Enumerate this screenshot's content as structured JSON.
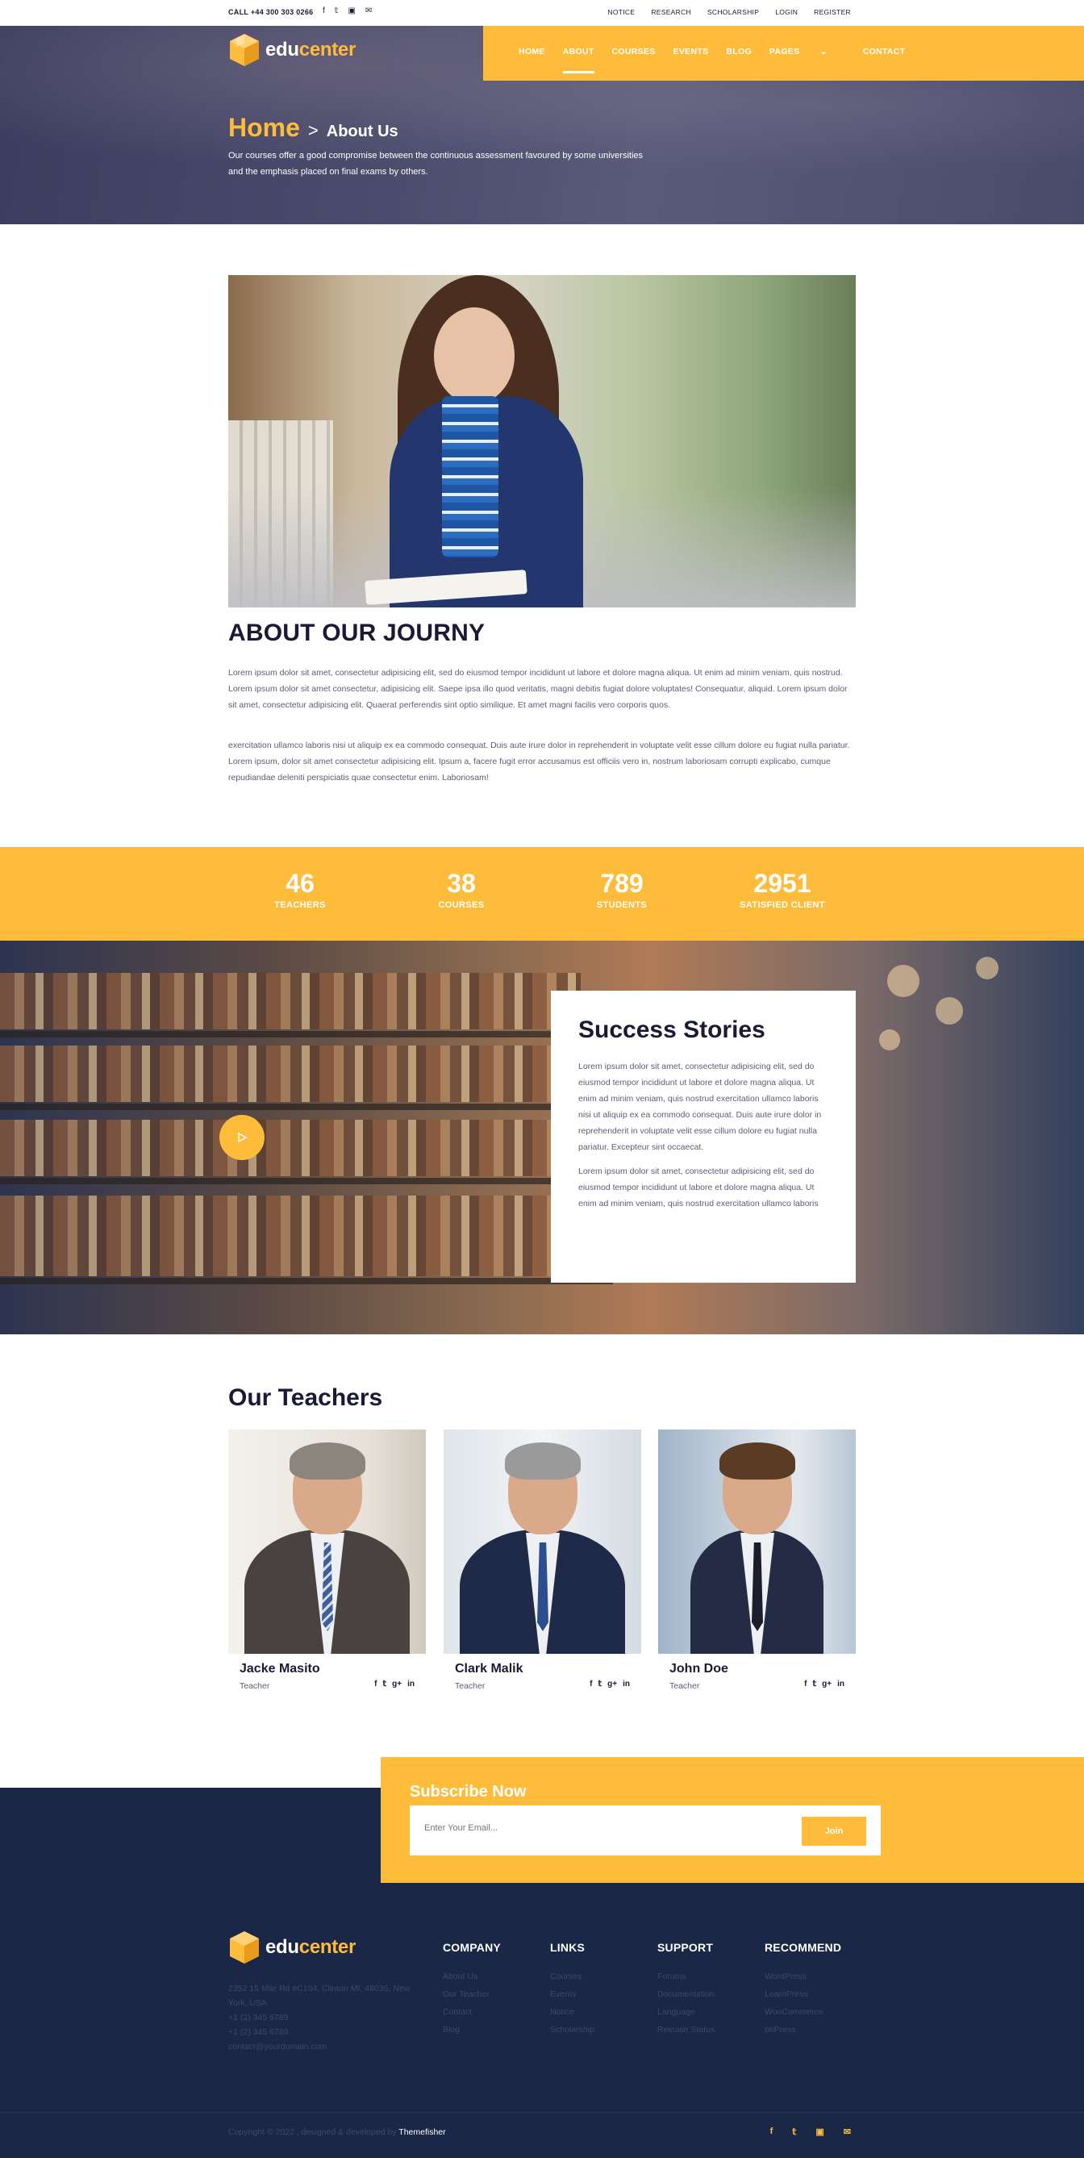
{
  "topbar": {
    "call": "CALL +44 300 303 0266",
    "social": [
      "f",
      "𝕥",
      "▣",
      "✉"
    ],
    "links": [
      "NOTICE",
      "RESEARCH",
      "SCHOLARSHIP",
      "LOGIN",
      "REGISTER"
    ]
  },
  "brand": {
    "edu": "edu",
    "center": "center"
  },
  "nav": {
    "items": [
      "HOME",
      "ABOUT",
      "COURSES",
      "EVENTS",
      "BLOG",
      "PAGES",
      "CONTACT"
    ],
    "active": "ABOUT"
  },
  "hero": {
    "home": "Home",
    "separator": ">",
    "current": "About Us",
    "description": "Our courses offer a good compromise between the continuous assessment favoured by some universities and the emphasis placed on final exams by others."
  },
  "about": {
    "title": "ABOUT OUR JOURNY",
    "p1": "Lorem ipsum dolor sit amet, consectetur adipisicing elit, sed do eiusmod tempor incididunt ut labore et dolore magna aliqua. Ut enim ad minim veniam, quis nostrud. Lorem ipsum dolor sit amet consectetur, adipisicing elit. Saepe ipsa illo quod veritatis, magni debitis fugiat dolore voluptates! Consequatur, aliquid. Lorem ipsum dolor sit amet, consectetur adipisicing elit. Quaerat perferendis sint optio similique. Et amet magni facilis vero corporis quos.",
    "p2": "exercitation ullamco laboris nisi ut aliquip ex ea commodo consequat. Duis aute irure dolor in reprehenderit in voluptate velit esse cillum dolore eu fugiat nulla pariatur. Lorem ipsum, dolor sit amet consectetur adipisicing elit. Ipsum a, facere fugit error accusamus est officiis vero in, nostrum laboriosam corrupti explicabo, cumque repudiandae deleniti perspiciatis quae consectetur enim. Laboriosam!"
  },
  "stats": [
    {
      "num": "46",
      "label": "TEACHERS"
    },
    {
      "num": "38",
      "label": "COURSES"
    },
    {
      "num": "789",
      "label": "STUDENTS"
    },
    {
      "num": "2951",
      "label": "SATISFIED CLIENT"
    }
  ],
  "success": {
    "title": "Success Stories",
    "p1": "Lorem ipsum dolor sit amet, consectetur adipisicing elit, sed do eiusmod tempor incididunt ut labore et dolore magna aliqua. Ut enim ad minim veniam, quis nostrud exercitation ullamco laboris nisi ut aliquip ex ea commodo consequat. Duis aute irure dolor in reprehenderit in voluptate velit esse cillum dolore eu fugiat nulla pariatur. Excepteur sint occaecat.",
    "p2": "Lorem ipsum dolor sit amet, consectetur adipisicing elit, sed do eiusmod tempor incididunt ut labore et dolore magna aliqua. Ut enim ad minim veniam, quis nostrud exercitation ullamco laboris"
  },
  "teachers": {
    "title": "Our Teachers",
    "items": [
      {
        "name": "Jacke Masito",
        "role": "Teacher"
      },
      {
        "name": "Clark Malik",
        "role": "Teacher"
      },
      {
        "name": "John Doe",
        "role": "Teacher"
      }
    ],
    "social": [
      "f",
      "𝕥",
      "g+",
      "in"
    ]
  },
  "subscribe": {
    "title": "Subscribe Now",
    "placeholder": "Enter Your Email...",
    "button": "Join"
  },
  "footer": {
    "address": "2352 15 Mile Rd #C104, Clinton MI, 48035, New York, USA",
    "phone1": "+1 (2) 345 6789",
    "phone2": "+1 (2) 345 6789",
    "email": "contact@yourdomain.com",
    "columns": [
      {
        "title": "COMPANY",
        "links": [
          "About Us",
          "Our Teacher",
          "Contact",
          "Blog"
        ]
      },
      {
        "title": "LINKS",
        "links": [
          "Courses",
          "Events",
          "Notice",
          "Scholarship"
        ]
      },
      {
        "title": "SUPPORT",
        "links": [
          "Forums",
          "Documentation",
          "Language",
          "Release Status"
        ]
      },
      {
        "title": "RECOMMEND",
        "links": [
          "WordPress",
          "LearnPress",
          "WooCommerce",
          "bbPress"
        ]
      }
    ],
    "copyright": "Copyright © 2022 , designed & developed by ",
    "copyright_brand": "Themefisher",
    "social": [
      "f",
      "𝕥",
      "▣",
      "✉"
    ]
  },
  "colors": {
    "accent": "#ffbc3b",
    "dark": "#1a1a37",
    "footer": "#1a2746"
  }
}
